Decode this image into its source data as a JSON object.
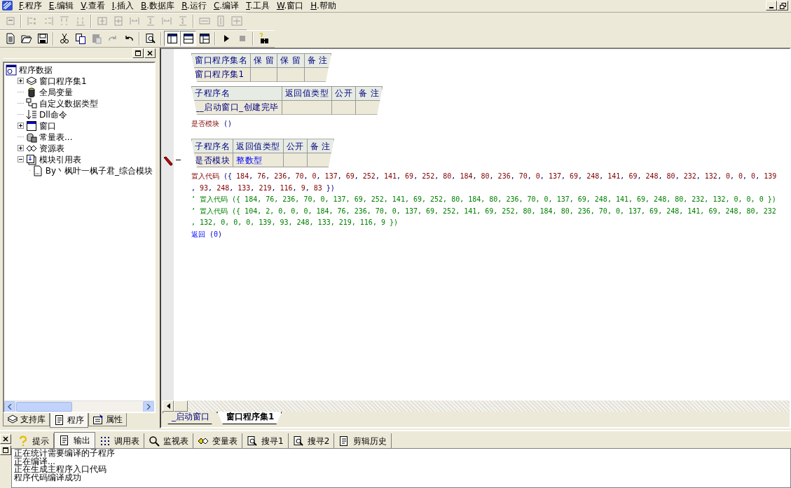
{
  "menu": [
    {
      "label": "F.程序"
    },
    {
      "label": "E.编辑"
    },
    {
      "label": "V.查看"
    },
    {
      "label": "I.插入"
    },
    {
      "label": "B.数据库"
    },
    {
      "label": "R.运行"
    },
    {
      "label": "C.编译"
    },
    {
      "label": "T.工具"
    },
    {
      "label": "W.窗口"
    },
    {
      "label": "H.帮助"
    }
  ],
  "toolbars": [
    [
      {
        "kind": "form",
        "disabled": true
      },
      {
        "kind": "sep"
      },
      {
        "kind": "align-left",
        "disabled": true
      },
      {
        "kind": "align-right",
        "disabled": true
      },
      {
        "kind": "align-top",
        "disabled": true
      },
      {
        "kind": "align-bottom",
        "disabled": true
      },
      {
        "kind": "sep"
      },
      {
        "kind": "center-h",
        "disabled": true
      },
      {
        "kind": "center-v",
        "disabled": true
      },
      {
        "kind": "space-h",
        "disabled": true
      },
      {
        "kind": "space-v",
        "disabled": true
      },
      {
        "kind": "space-h",
        "disabled": true
      },
      {
        "kind": "space-v",
        "disabled": true
      },
      {
        "kind": "sep"
      },
      {
        "kind": "same-width",
        "disabled": true
      },
      {
        "kind": "same-height",
        "disabled": true
      },
      {
        "kind": "same-size",
        "disabled": true
      }
    ],
    [
      {
        "kind": "new",
        "disabled": false
      },
      {
        "kind": "open",
        "disabled": false
      },
      {
        "kind": "save",
        "disabled": false
      },
      {
        "kind": "sep"
      },
      {
        "kind": "cut",
        "disabled": false
      },
      {
        "kind": "copy",
        "disabled": false
      },
      {
        "kind": "paste",
        "disabled": true
      },
      {
        "kind": "redo",
        "disabled": true
      },
      {
        "kind": "undo",
        "disabled": false
      },
      {
        "kind": "sep"
      },
      {
        "kind": "find",
        "disabled": false
      },
      {
        "kind": "sep"
      },
      {
        "kind": "layout1",
        "disabled": false,
        "pressed": true
      },
      {
        "kind": "layout2",
        "disabled": false,
        "pressed": true
      },
      {
        "kind": "layout3",
        "disabled": false,
        "pressed": false
      },
      {
        "kind": "sep"
      },
      {
        "kind": "run",
        "disabled": false
      },
      {
        "kind": "stop",
        "disabled": true
      },
      {
        "kind": "sep"
      },
      {
        "kind": "help",
        "disabled": false
      }
    ]
  ],
  "tree": {
    "label": "程序数据",
    "kind": "app",
    "children": [
      {
        "label": "窗口程序集1",
        "kind": "stack",
        "expanded": false
      },
      {
        "label": "全局变量",
        "kind": "db"
      },
      {
        "label": "自定义数据类型",
        "kind": "types"
      },
      {
        "label": "Dll命令",
        "kind": "dll"
      },
      {
        "label": "窗口",
        "kind": "window",
        "expanded": false
      },
      {
        "label": "常量表...",
        "kind": "const"
      },
      {
        "label": "资源表",
        "kind": "resource",
        "expanded": false
      },
      {
        "label": "模块引用表",
        "kind": "module",
        "expanded": true,
        "children": [
          {
            "label": "By丶枫叶一枫子君_综合模块",
            "kind": "file"
          }
        ]
      }
    ]
  },
  "left_tabs": [
    {
      "label": "支持库",
      "kind": "books",
      "selected": false
    },
    {
      "label": "程序",
      "kind": "doc",
      "selected": true
    },
    {
      "label": "属性",
      "kind": "props",
      "selected": false
    }
  ],
  "editor": {
    "blocks": [
      {
        "kind": "table",
        "cursor": false,
        "columns": [
          "窗口程序集名",
          "保 留",
          "保 留",
          "备 注"
        ],
        "rows": [
          {
            "cells": [
              {
                "text": "窗口程序集1",
                "kind": "name"
              }
            ]
          }
        ]
      },
      {
        "kind": "table",
        "cursor": false,
        "columns": [
          "子程序名",
          "返回值类型",
          "公开",
          "备 注"
        ],
        "rows": [
          {
            "cells": [
              {
                "text": "__启动窗口_创建完毕",
                "kind": "name"
              }
            ]
          }
        ]
      },
      {
        "kind": "code",
        "lines": [
          {
            "kind": "call",
            "text": "是否模块 ()"
          }
        ]
      },
      {
        "kind": "table",
        "cursor": true,
        "columns": [
          "子程序名",
          "返回值类型",
          "公开",
          "备 注"
        ],
        "rows": [
          {
            "cells": [
              {
                "text": "是否模块",
                "kind": "name"
              },
              {
                "text": "整数型",
                "kind": "type"
              }
            ]
          }
        ]
      },
      {
        "kind": "code",
        "lines": [
          {
            "kind": "call",
            "text": "置入代码 ({ 184, 76, 236, 70, 0, 137, 69, 252, 141, 69, 252, 80, 184, 80, 236, 70, 0, 137, 69, 248, 141, 69, 248, 80, 232, 132, 0, 0, 0, 139"
          },
          {
            "kind": "call",
            "text": ", 93, 248, 133, 219, 116, 9, 83 })"
          },
          {
            "kind": "comment",
            "text": "’ 置入代码 ({ 184, 76, 236, 70, 0, 137, 69, 252, 141, 69, 252, 80, 184, 80, 236, 70, 0, 137, 69, 248, 141, 69, 248, 80, 232, 132, 0, 0, 0 })"
          },
          {
            "kind": "comment",
            "text": "’ 置入代码 ({ 104, 2, 0, 0, 0, 184, 76, 236, 70, 0, 137, 69, 252, 141, 69, 252, 80, 184, 80, 236, 70, 0, 137, 69, 248, 141, 69, 248, 80, 232"
          },
          {
            "kind": "comment",
            "text": ", 132, 0, 0, 0, 139, 93, 248, 133, 219, 116, 9 })"
          },
          {
            "kind": "return",
            "text": "返回 (0)"
          }
        ]
      }
    ],
    "tabs": [
      {
        "label": "_启动窗口",
        "selected": false
      },
      {
        "label": "窗口程序集1",
        "selected": true
      }
    ]
  },
  "bottom_tabs": [
    {
      "label": "提示",
      "kind": "question",
      "selected": false
    },
    {
      "label": "输出",
      "kind": "doc",
      "selected": true
    },
    {
      "label": "调用表",
      "kind": "dots",
      "selected": false
    },
    {
      "label": "监视表",
      "kind": "magnifier",
      "selected": false
    },
    {
      "label": "变量表",
      "kind": "diamonds",
      "selected": false
    },
    {
      "label": "搜寻1",
      "kind": "find",
      "selected": false
    },
    {
      "label": "搜寻2",
      "kind": "find",
      "selected": false
    },
    {
      "label": "剪辑历史",
      "kind": "doc",
      "selected": false
    }
  ],
  "output": [
    "正在统计需要编译的子程序",
    "正在编译...",
    "正在生成主程序入口代码",
    "程序代码编译成功"
  ]
}
